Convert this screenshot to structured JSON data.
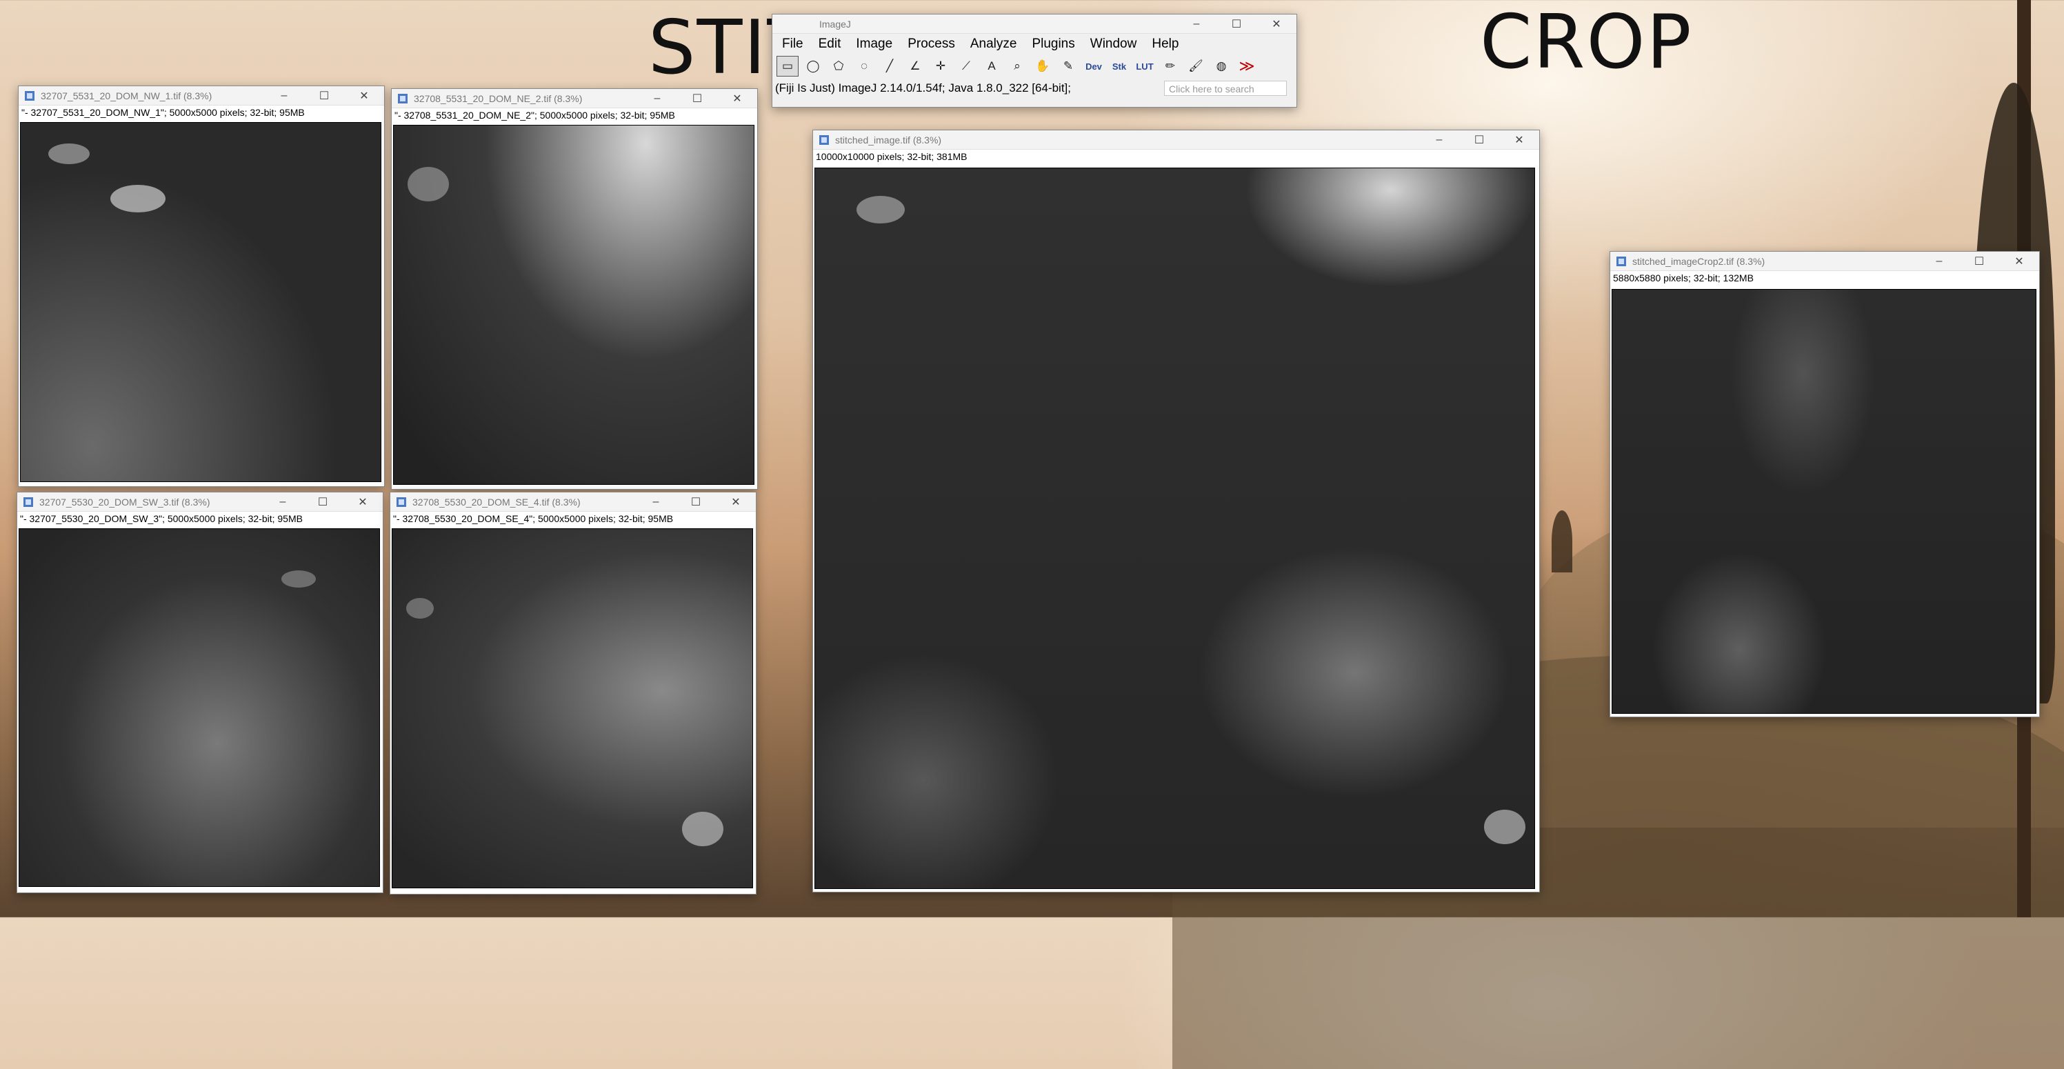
{
  "desktop": {
    "labels": {
      "stitch": "STITCH",
      "crop": "CROP"
    }
  },
  "fiji": {
    "title": "ImageJ",
    "menu": [
      "File",
      "Edit",
      "Image",
      "Process",
      "Analyze",
      "Plugins",
      "Window",
      "Help"
    ],
    "tools": [
      "rectangle-tool",
      "oval-tool",
      "polygon-tool",
      "freehand-tool",
      "line-tool",
      "angle-tool",
      "point-tool",
      "wand-tool",
      "text-tool",
      "magnifier-tool",
      "hand-tool",
      "dropper-tool"
    ],
    "tool_extras": {
      "dev": "Dev",
      "stk": "Stk",
      "lut": "LUT"
    },
    "status": "(Fiji Is Just) ImageJ 2.14.0/1.54f; Java 1.8.0_322 [64-bit];",
    "search_placeholder": "Click here to search"
  },
  "windows": {
    "nw": {
      "title": "32707_5531_20_DOM_NW_1.tif (8.3%)",
      "info": "\"- 32707_5531_20_DOM_NW_1\"; 5000x5000 pixels; 32-bit; 95MB"
    },
    "ne": {
      "title": "32708_5531_20_DOM_NE_2.tif (8.3%)",
      "info": "\"- 32708_5531_20_DOM_NE_2\"; 5000x5000 pixels; 32-bit; 95MB"
    },
    "sw": {
      "title": "32707_5530_20_DOM_SW_3.tif (8.3%)",
      "info": "\"- 32707_5530_20_DOM_SW_3\"; 5000x5000 pixels; 32-bit; 95MB"
    },
    "se": {
      "title": "32708_5530_20_DOM_SE_4.tif (8.3%)",
      "info": "\"- 32708_5530_20_DOM_SE_4\"; 5000x5000 pixels; 32-bit; 95MB"
    },
    "stitched": {
      "title": "stitched_image.tif (8.3%)",
      "info": "10000x10000 pixels; 32-bit; 381MB"
    },
    "crop": {
      "title": "stitched_imageCrop2.tif (8.3%)",
      "info": "5880x5880 pixels; 32-bit; 132MB"
    }
  },
  "window_controls": {
    "minimize": "–",
    "maximize": "☐",
    "close": "✕"
  }
}
